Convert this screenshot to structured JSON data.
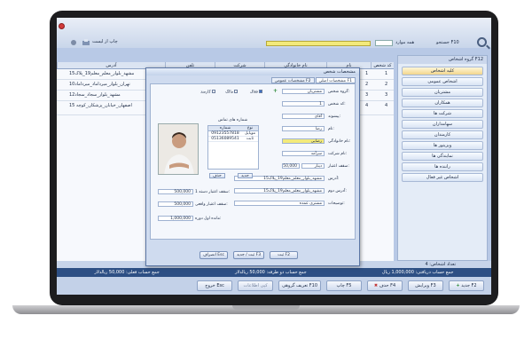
{
  "window": {
    "search_label": "جستجو F10",
    "group_select": "همه موارد",
    "print_label": "چاپ از لیست"
  },
  "grid": {
    "columns": [
      "کد شخص",
      "نام",
      "نام خانوادگی",
      "شرکت",
      "تلفن",
      "آدرس"
    ],
    "rows": [
      {
        "id": "1",
        "num": "1",
        "address": "مشهد_بلوار_معلم_معلم19_پلاک15"
      },
      {
        "id": "2",
        "num": "2",
        "address": "تهران_بلوار_میرداماد_میرداماد10"
      },
      {
        "id": "3",
        "num": "3",
        "address": "مشهد_بلوار_سجاد_سجاد12"
      },
      {
        "id": "4",
        "num": "4",
        "address": "اصفهان_خیابان_پزشکان_کوچه 15"
      }
    ]
  },
  "sidebar": {
    "title": "گروه اشخاص F12",
    "items": [
      "کلیه اشخاص",
      "اشخاص عمومی",
      "مشتریان",
      "همکاران",
      "شرکت ها",
      "سهامداران",
      "کارمندان",
      "ویزیتور ها",
      "نمایندگی ها",
      "راننده ها",
      "اشخاص غیر فعال"
    ]
  },
  "status": {
    "count_label": "تعداد اشخاص: 4",
    "sum_in": "جمع حساب دریافتی: 1,000,000 ریال",
    "sum_out": "جمع حساب دو طرفه: 50,000 ریالدلار",
    "sum_bal": "جمع حساب فعلی: 50,000 ریالدلار"
  },
  "bottom_buttons": [
    "جدید F2",
    "ویرایش F3",
    "حذف F4",
    "چاپ F5",
    "تعریف گروهی F10",
    "کپی اطلاعات",
    "خروج Esc"
  ],
  "dialog": {
    "title": "مشخصات شخص",
    "tabs": [
      "مشخصات اصلی F1",
      "مشخصات عمومی F2"
    ],
    "labels": {
      "group": "گروه شخص:",
      "code": "کد شخص:",
      "prefix": "پیشوند:",
      "first": "نام:",
      "last": "نام خانوادگی:",
      "company": "نام شرکت:",
      "credit": "سقف اعتبار:",
      "address": "آدرس:",
      "address2": "آدرس دوم:",
      "desc": "توضیحات:",
      "phones": "شماره های تماس",
      "balance_in": "سقف اعتبار دسته 1:",
      "balance_out": "سقف اعتبار واقعی:",
      "open": "مانده اول دوره:"
    },
    "values": {
      "group": "مشتریان",
      "code": "1",
      "prefix": "آقای",
      "first": "رضا",
      "last": "رضایی",
      "company": "سرآمد",
      "credit": "50,000",
      "credit_unit": "دینار",
      "address": "مشهد_بلوار_معلم_معلم19_پلاک15",
      "address2": "مشهد_بلوار_معلم_معلم19_پلاک15",
      "desc": "مشتری عمده",
      "balance_in": "500,000",
      "balance_out": "500,000",
      "open": "1,000,000"
    },
    "checks": [
      "فعال",
      "مالک",
      "کارمند"
    ],
    "phone_headers": [
      "نوع",
      "شماره"
    ],
    "phones": [
      {
        "type": "موبایل",
        "number": "09123557818"
      },
      {
        "type": "ثابت",
        "number": "05136089541"
      }
    ],
    "phone_add": "جدید",
    "phone_del": "حذف",
    "buttons": [
      "ثبت F2",
      "ثبت / جدید F3",
      "انصراف Esc"
    ]
  }
}
